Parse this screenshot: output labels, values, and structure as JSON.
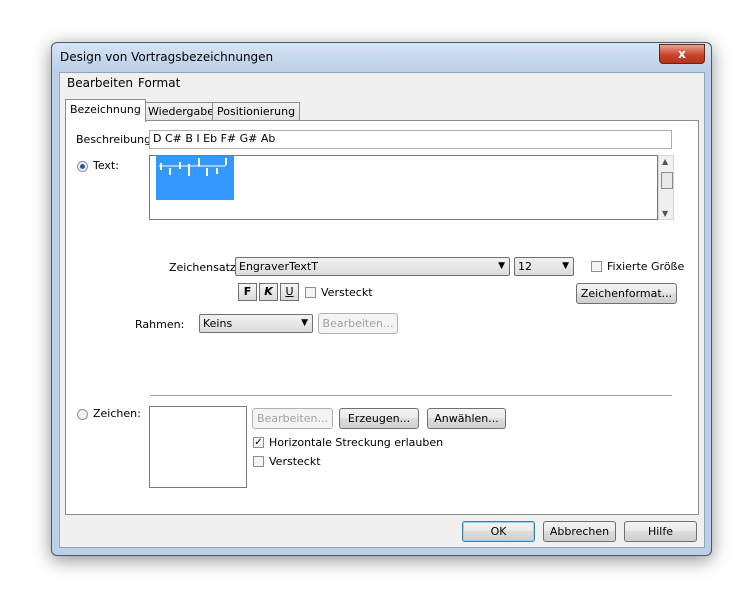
{
  "window": {
    "title": "Design von Vortragsbezeichnungen",
    "close_glyph": "x"
  },
  "menu": [
    "Bearbeiten",
    "Format"
  ],
  "tabs": [
    {
      "label": "Bezeichnung",
      "active": true
    },
    {
      "label": "Wiedergabe",
      "active": false
    },
    {
      "label": "Positionierung",
      "active": false
    }
  ],
  "beschreibung": {
    "label": "Beschreibung:",
    "value": "D C# B I Eb F# G# Ab"
  },
  "text_option": {
    "label": "Text:",
    "selected": true
  },
  "font": {
    "label": "Zeichensatz:",
    "value": "EngraverTextT",
    "size": "12",
    "fixed_size_label": "Fixierte Größe",
    "bold": "F",
    "italic": "K",
    "underline": "U",
    "hidden_label": "Versteckt",
    "format_button": "Zeichenformat..."
  },
  "frame": {
    "label": "Rahmen:",
    "value": "Keins",
    "edit_button": "Bearbeiten..."
  },
  "symbol_option": {
    "label": "Zeichen:",
    "selected": false,
    "edit_button": "Bearbeiten...",
    "create_button": "Erzeugen...",
    "select_button": "Anwählen...",
    "stretch_label": "Horizontale Streckung erlauben",
    "stretch_checked": true,
    "hidden_label": "Versteckt",
    "hidden_checked": false
  },
  "footer": {
    "ok": "OK",
    "cancel": "Abbrechen",
    "help": "Hilfe"
  },
  "colors": {
    "selection": "#3399ff",
    "title_gradient_top": "#d7e5f4",
    "close_red": "#c7452c"
  }
}
